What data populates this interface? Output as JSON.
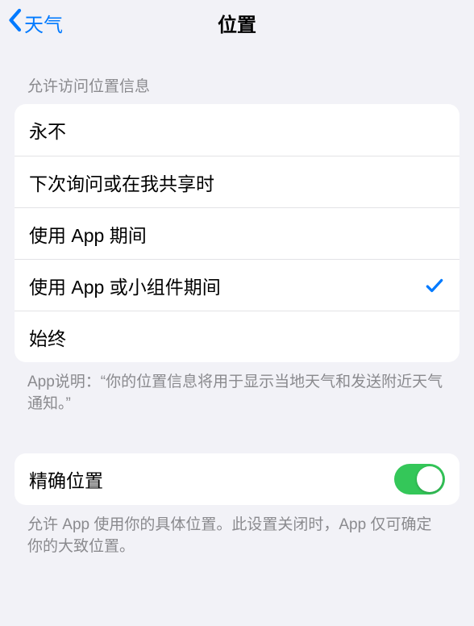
{
  "nav": {
    "back_label": "天气",
    "title": "位置"
  },
  "section1": {
    "header": "允许访问位置信息",
    "options": [
      {
        "label": "永不",
        "selected": false
      },
      {
        "label": "下次询问或在我共享时",
        "selected": false
      },
      {
        "label": "使用 App 期间",
        "selected": false
      },
      {
        "label": "使用 App 或小组件期间",
        "selected": true
      },
      {
        "label": "始终",
        "selected": false
      }
    ],
    "footer": "App说明：“你的位置信息将用于显示当地天气和发送附近天气通知。”"
  },
  "section2": {
    "precise_label": "精确位置",
    "precise_on": true,
    "footer": "允许 App 使用你的具体位置。此设置关闭时，App 仅可确定你的大致位置。"
  }
}
